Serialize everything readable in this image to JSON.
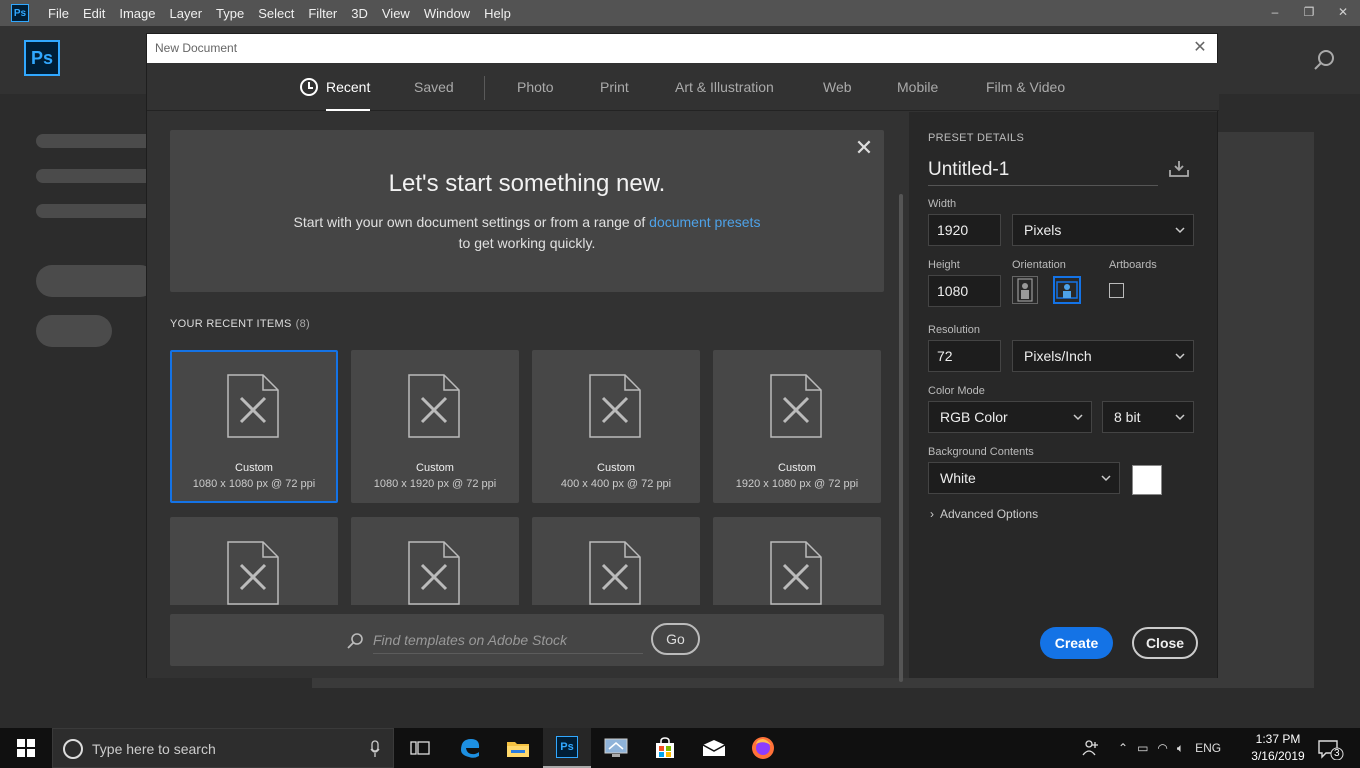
{
  "app": {
    "mini_logo": "Ps",
    "big_logo": "Ps",
    "menu": [
      "File",
      "Edit",
      "Image",
      "Layer",
      "Type",
      "Select",
      "Filter",
      "3D",
      "View",
      "Window",
      "Help"
    ],
    "window_controls": [
      "–",
      "❐",
      "✕"
    ]
  },
  "dialog": {
    "title": "New Document",
    "close_glyph": "✕",
    "tabs": [
      {
        "label": "Recent",
        "active": true
      },
      {
        "label": "Saved"
      },
      {
        "label": "Photo"
      },
      {
        "label": "Print"
      },
      {
        "label": "Art & Illustration"
      },
      {
        "label": "Web"
      },
      {
        "label": "Mobile"
      },
      {
        "label": "Film & Video"
      }
    ],
    "welcome": {
      "heading": "Let's start something new.",
      "line1_pre": "Start with your own document settings or from a range of ",
      "link": "document presets",
      "line2": "to get working quickly.",
      "close_glyph": "✕"
    },
    "recent": {
      "heading": "YOUR RECENT ITEMS",
      "count": "(8)",
      "items": [
        {
          "name": "Custom",
          "meta": "1080 x 1080 px @ 72 ppi",
          "selected": true
        },
        {
          "name": "Custom",
          "meta": "1080 x 1920 px @ 72 ppi"
        },
        {
          "name": "Custom",
          "meta": "400 x 400 px @ 72 ppi"
        },
        {
          "name": "Custom",
          "meta": "1920 x 1080 px @ 72 ppi"
        },
        {
          "name": "",
          "meta": ""
        },
        {
          "name": "",
          "meta": ""
        },
        {
          "name": "",
          "meta": ""
        },
        {
          "name": "",
          "meta": ""
        }
      ]
    },
    "stock": {
      "placeholder": "Find templates on Adobe Stock",
      "go_label": "Go"
    },
    "details": {
      "section_title": "PRESET DETAILS",
      "doc_name": "Untitled-1",
      "width_label": "Width",
      "width_value": "1920",
      "width_unit": "Pixels",
      "height_label": "Height",
      "height_value": "1080",
      "orientation_label": "Orientation",
      "artboards_label": "Artboards",
      "resolution_label": "Resolution",
      "resolution_value": "72",
      "resolution_unit": "Pixels/Inch",
      "color_mode_label": "Color Mode",
      "color_mode": "RGB Color",
      "bit_depth": "8 bit",
      "background_label": "Background Contents",
      "background": "White",
      "advanced": "Advanced Options",
      "create_label": "Create",
      "close_label": "Close"
    }
  },
  "taskbar": {
    "search_placeholder": "Type here to search",
    "ps_label": "Ps",
    "language": "ENG",
    "time": "1:37 PM",
    "date": "3/16/2019",
    "notifications": "3"
  },
  "colors": {
    "accent_blue": "#1473e6",
    "link_blue": "#4ea2e8",
    "ps_blue": "#31a8ff"
  }
}
